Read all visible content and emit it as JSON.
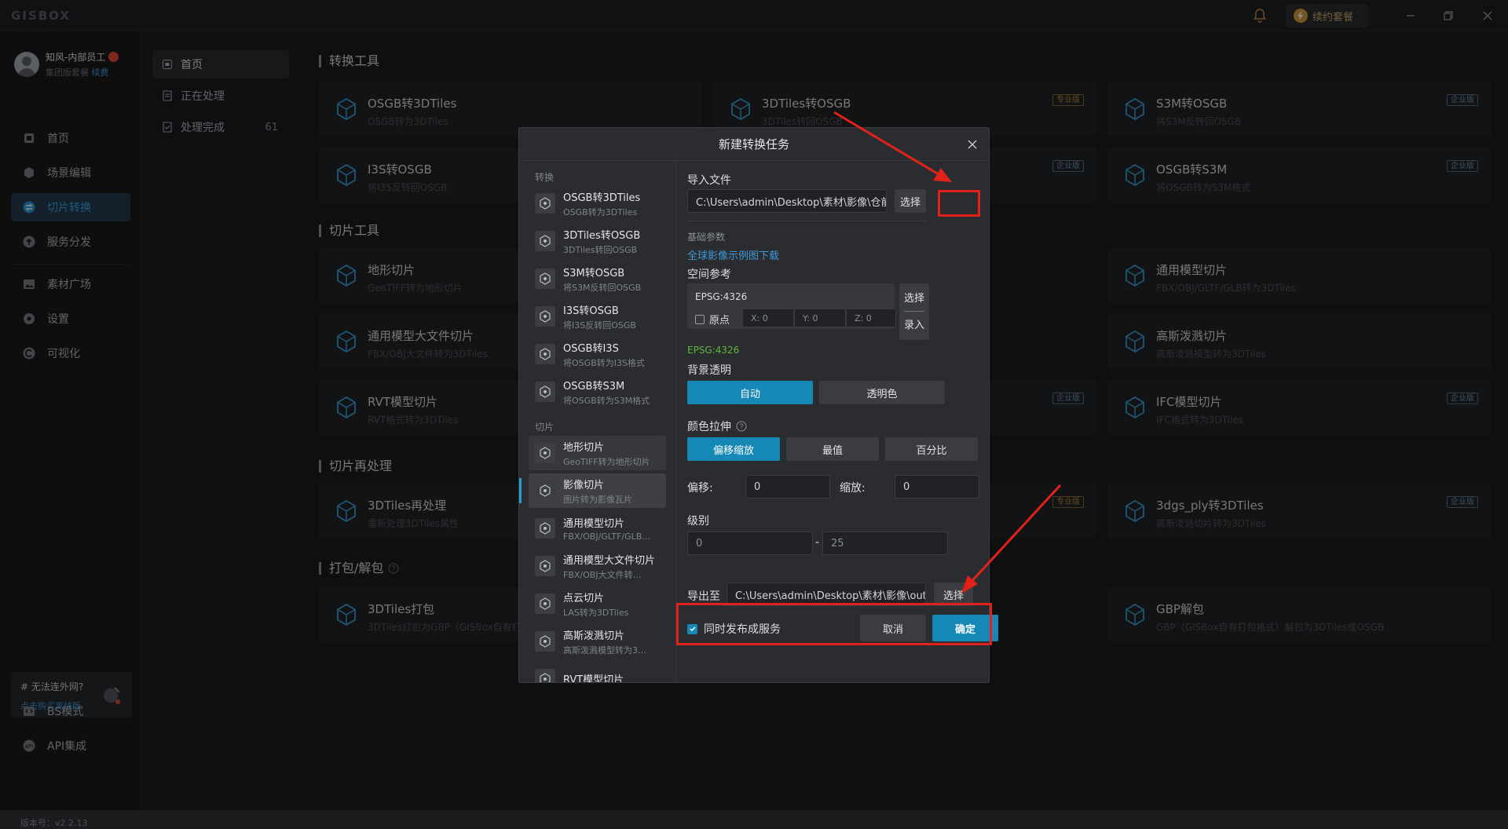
{
  "app": {
    "logo": "GISBOX",
    "plan_label": "续约套餐"
  },
  "user": {
    "name": "知风-内部员工",
    "sub": "集团版套餐",
    "renew": "续费"
  },
  "sidebar": {
    "items": [
      {
        "label": "首页",
        "icon": "home-icon"
      },
      {
        "label": "场景编辑",
        "icon": "cube-icon"
      },
      {
        "label": "切片转换",
        "icon": "convert-icon",
        "active": true
      },
      {
        "label": "服务分发",
        "icon": "upload-icon"
      },
      {
        "label": "素材广场",
        "icon": "image-icon"
      },
      {
        "label": "设置",
        "icon": "gear-icon"
      },
      {
        "label": "可视化",
        "icon": "chart-icon"
      }
    ],
    "promo_title": "# 无法连外网?",
    "promo_link": "点击购买离线版",
    "bottom": [
      {
        "label": "BS模式"
      },
      {
        "label": "API集成"
      }
    ],
    "version": "版本号：v2.2.13"
  },
  "subnav": {
    "items": [
      {
        "label": "首页",
        "active": true
      },
      {
        "label": "正在处理"
      },
      {
        "label": "处理完成",
        "count": "61"
      }
    ]
  },
  "main": {
    "sections": [
      "转换工具",
      "切片工具",
      "切片再处理",
      "打包/解包"
    ],
    "cards": [
      {
        "title": "OSGB转3DTiles",
        "sub": "OSGB转为3DTiles",
        "edition": ""
      },
      {
        "title": "3DTiles转OSGB",
        "sub": "3DTiles转回OSGB",
        "edition": "专业版"
      },
      {
        "title": "S3M转OSGB",
        "sub": "将S3M反转回OSGB",
        "edition": "企业版"
      },
      {
        "title": "I3S转OSGB",
        "sub": "将I3S反转回OSGB",
        "edition": ""
      },
      {
        "title": "",
        "sub": "",
        "edition": "企业版"
      },
      {
        "title": "OSGB转S3M",
        "sub": "将OSGB转为S3M格式",
        "edition": "企业版"
      },
      {
        "title": "地形切片",
        "sub": "GeoTIFF转为地形切片",
        "edition": ""
      },
      {
        "title": "通用模型切片",
        "sub": "FBX/OBJ/GLTF/GLB转为3DTiles",
        "edition": ""
      },
      {
        "title": "通用模型大文件切片",
        "sub": "FBX/OBJ大文件转为3DTiles",
        "edition": ""
      },
      {
        "title": "高斯泼溅切片",
        "sub": "高斯泼溅模型转为3DTiles",
        "edition": ""
      },
      {
        "title": "RVT模型切片",
        "sub": "RVT格式转为3DTiles",
        "edition": ""
      },
      {
        "title": "",
        "sub": "",
        "edition": "企业版"
      },
      {
        "title": "IFC模型切片",
        "sub": "IFC格式转为3DTiles",
        "edition": "企业版"
      },
      {
        "title": "3DTiles再处理",
        "sub": "重新处理3DTiles属性",
        "edition": ""
      },
      {
        "title": "",
        "sub": "",
        "edition": "专业版"
      },
      {
        "title": "3dgs_ply转3DTiles",
        "sub": "高斯泼溅切片转为3DTiles",
        "edition": "企业版"
      },
      {
        "title": "3DTiles打包",
        "sub": "3DTiles打包为GBP（GISBox自有打",
        "edition": ""
      },
      {
        "title": "GBP解包",
        "sub": "GBP（GISBox自有打包格式）解包为3DTiles或OSGB",
        "edition": ""
      }
    ]
  },
  "modal": {
    "title": "新建转换任务",
    "group_convert": "转换",
    "group_slice": "切片",
    "convert_items": [
      {
        "title": "OSGB转3DTiles",
        "sub": "OSGB转为3DTiles"
      },
      {
        "title": "3DTiles转OSGB",
        "sub": "3DTiles转回OSGB"
      },
      {
        "title": "S3M转OSGB",
        "sub": "将S3M反转回OSGB"
      },
      {
        "title": "I3S转OSGB",
        "sub": "将I3S反转回OSGB"
      },
      {
        "title": "OSGB转I3S",
        "sub": "将OSGB转为I3S格式"
      },
      {
        "title": "OSGB转S3M",
        "sub": "将OSGB转为S3M格式"
      }
    ],
    "slice_items": [
      {
        "title": "地形切片",
        "sub": "GeoTIFF转为地形切片"
      },
      {
        "title": "影像切片",
        "sub": "图片转为影像瓦片"
      },
      {
        "title": "通用模型切片",
        "sub": "FBX/OBJ/GLTF/GLB…"
      },
      {
        "title": "通用模型大文件切片",
        "sub": "FBX/OBJ大文件转…"
      },
      {
        "title": "点云切片",
        "sub": "LAS转为3DTiles"
      },
      {
        "title": "高斯泼溅切片",
        "sub": "高斯泼溅模型转为3…"
      },
      {
        "title": "RVT模型切片",
        "sub": ""
      }
    ],
    "import_label": "导入文件",
    "import_path": "C:\\Users\\admin\\Desktop\\素材\\影像\\仓前街道_…",
    "choose": "选择",
    "basic_params": "基础参数",
    "sample_link": "全球影像示例图下载",
    "spatial_ref": "空间参考",
    "epsg_value": "EPSG:4326",
    "origin_label": "原点",
    "x_label": "X: 0",
    "y_label": "Y: 0",
    "z_label": "Z: 0",
    "side_choose": "选择",
    "side_enter": "录入",
    "epsg_note": "EPSG:4326",
    "bg_label": "背景透明",
    "bg_auto": "自动",
    "bg_transparent": "透明色",
    "stretch_label": "颜色拉伸",
    "stretch_opts": [
      "偏移缩放",
      "最值",
      "百分比"
    ],
    "offset_label": "偏移:",
    "offset_value": "0",
    "scale_label": "缩放:",
    "scale_value": "0",
    "level_label": "级别",
    "level_min": "0",
    "level_sep": "-",
    "level_max": "25",
    "export_label": "导出至",
    "export_path": "C:\\Users\\admin\\Desktop\\素材\\影像\\out…",
    "publish_label": "同时发布成服务",
    "cancel": "取消",
    "ok": "确定"
  },
  "colors": {
    "accent": "#1688b5",
    "annotation": "#e0221b",
    "link": "#3b9ad9",
    "epsg_green": "#5fb83a"
  }
}
